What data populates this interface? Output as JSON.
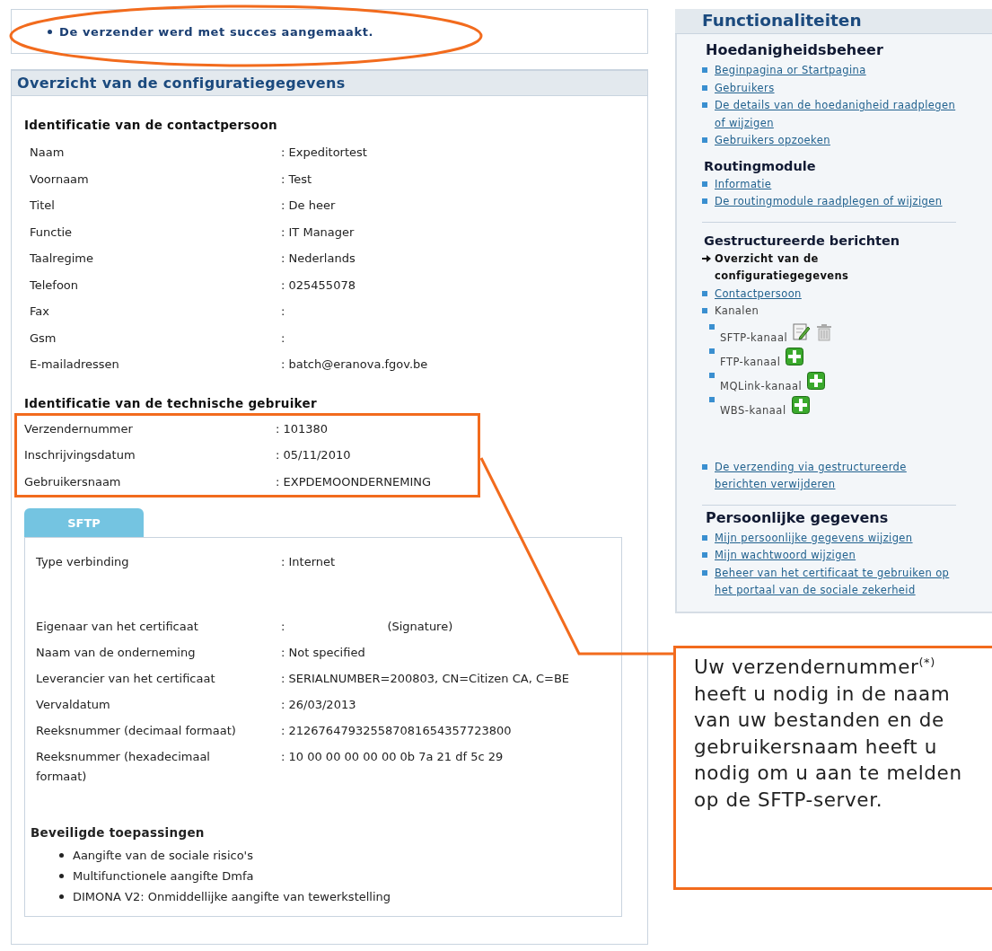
{
  "message": {
    "text": "De verzender werd met succes aangemaakt."
  },
  "overview": {
    "title": "Overzicht van de configuratiegegevens",
    "sections": [
      {
        "heading": "Identificatie van de contactpersoon",
        "highlighted": false,
        "rows": [
          {
            "label": "Naam",
            "value": ": Expeditortest"
          },
          {
            "label": "Voornaam",
            "value": ": Test"
          },
          {
            "label": "Titel",
            "value": ": De heer"
          },
          {
            "label": "Functie",
            "value": ": IT Manager"
          },
          {
            "label": "Taalregime",
            "value": ": Nederlands"
          },
          {
            "label": "Telefoon",
            "value": ": 025455078"
          },
          {
            "label": "Fax",
            "value": ":"
          },
          {
            "label": "Gsm",
            "value": ":"
          },
          {
            "label": "E-mailadressen",
            "value": ": batch@eranova.fgov.be"
          }
        ]
      },
      {
        "heading": "Identificatie van de technische gebruiker",
        "highlighted": true,
        "rows": [
          {
            "label": "Verzendernummer",
            "value": ": 101380"
          },
          {
            "label": "Inschrijvingsdatum",
            "value": ": 05/11/2010"
          },
          {
            "label": "Gebruikersnaam",
            "value": ": EXPDEMOONDERNEMING"
          }
        ]
      }
    ]
  },
  "channel_tabs": [
    {
      "label": "SFTP",
      "selected": true
    }
  ],
  "channel": {
    "connection_rows": [
      {
        "label": "Type verbinding",
        "value": ": Internet"
      }
    ],
    "certificate_rows": [
      {
        "label": "Eigenaar van het certificaat",
        "value": ":",
        "note": "(Signature)"
      },
      {
        "label": "Naam van de onderneming",
        "value": ": Not specified"
      },
      {
        "label": "Leverancier van het certificaat",
        "value": ": SERIALNUMBER=200803, CN=Citizen CA, C=BE"
      },
      {
        "label": "Vervaldatum",
        "value": ": 26/03/2013"
      },
      {
        "label": "Reeksnummer (decimaal formaat)",
        "value": ": 212676479325587081654357723800"
      },
      {
        "label": "Reeksnummer (hexadecimaal formaat)",
        "value": ": 10 00 00 00 00 00 0b 7a 21 df 5c 29"
      }
    ],
    "applications": {
      "heading": "Beveiligde toepassingen",
      "items": [
        "Aangifte van de sociale risico's",
        "Multifunctionele aangifte Dmfa",
        "DIMONA V2: Onmiddellijke aangifte van tewerkstelling"
      ]
    }
  },
  "sidebar": {
    "title": "Functionaliteiten",
    "groups": [
      {
        "heading": "Hoedanigheidsbeheer",
        "kind": "major",
        "items": [
          {
            "kind": "link",
            "label": "Beginpagina or Startpagina"
          },
          {
            "kind": "link",
            "label": "Gebruikers"
          },
          {
            "kind": "link",
            "label": "De details van de hoedanigheid raadplegen of wijzigen"
          },
          {
            "kind": "link",
            "label": "Gebruikers opzoeken"
          }
        ]
      },
      {
        "heading": "Routingmodule",
        "kind": "minor",
        "items": [
          {
            "kind": "link",
            "label": "Informatie"
          },
          {
            "kind": "link",
            "label": "De routingmodule raadplegen of wijzigen"
          }
        ]
      },
      {
        "heading": "Gestructureerde berichten",
        "kind": "minor",
        "items": [
          {
            "kind": "current",
            "label": "Overzicht van de configuratiegegevens"
          },
          {
            "kind": "link",
            "label": "Contactpersoon"
          },
          {
            "kind": "plain",
            "label": "Kanalen",
            "children": [
              {
                "label": "SFTP-kanaal",
                "actions": [
                  {
                    "kind": "edit"
                  },
                  {
                    "kind": "delete"
                  }
                ]
              },
              {
                "label": "FTP-kanaal",
                "actions": [
                  {
                    "kind": "add"
                  }
                ]
              },
              {
                "label": "MQLink-kanaal",
                "actions": [
                  {
                    "kind": "add"
                  }
                ]
              },
              {
                "label": "WBS-kanaal",
                "actions": [
                  {
                    "kind": "add"
                  }
                ]
              }
            ]
          },
          {
            "kind": "link",
            "label": "De verzending via gestructureerde berichten verwijderen"
          }
        ]
      },
      {
        "heading": "Persoonlijke gegevens",
        "kind": "major",
        "items": [
          {
            "kind": "link",
            "label": "Mijn persoonlijke gegevens wijzigen"
          },
          {
            "kind": "link",
            "label": "Mijn wachtwoord wijzigen"
          },
          {
            "kind": "link",
            "label": "Beheer van het certificaat te gebruiken op het portaal van de sociale zekerheid"
          }
        ]
      }
    ]
  },
  "callout": {
    "text": "Uw verzendernummer$^{(*)}$ heeft u nodig in de naam van uw bestanden en de gebruikersnaam heeft u nodig om u aan te melden op de SFTP-server."
  }
}
